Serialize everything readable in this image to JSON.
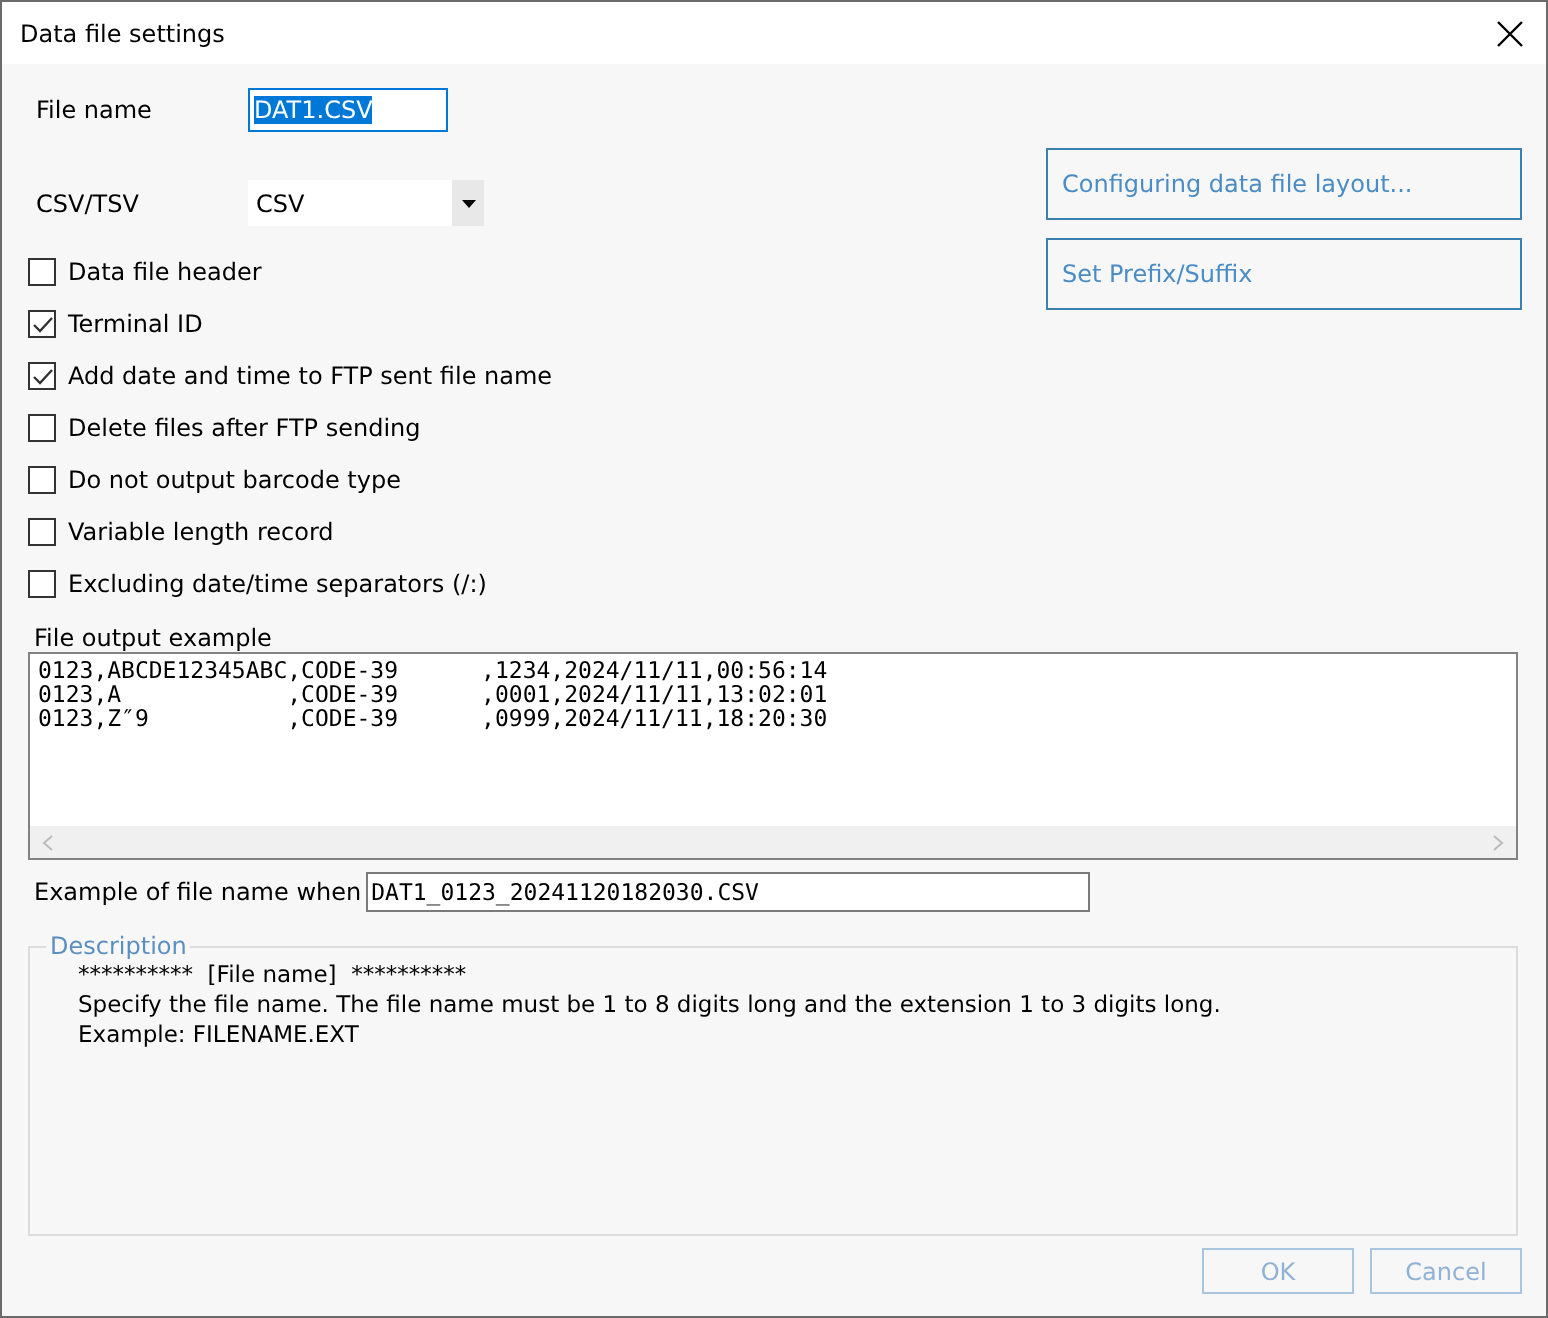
{
  "window": {
    "title": "Data file settings"
  },
  "file_name": {
    "label": "File name",
    "value": "DAT1.CSV"
  },
  "format": {
    "label": "CSV/TSV",
    "value": "CSV"
  },
  "options": [
    {
      "label": "Data file header",
      "checked": false
    },
    {
      "label": "Terminal ID",
      "checked": true
    },
    {
      "label": "Add date and time to FTP sent file name",
      "checked": true
    },
    {
      "label": "Delete files after FTP sending",
      "checked": false
    },
    {
      "label": "Do not output barcode type",
      "checked": false
    },
    {
      "label": "Variable length record",
      "checked": false
    },
    {
      "label": "Excluding date/time separators (/:)",
      "checked": false
    }
  ],
  "side_buttons": [
    "Configuring data file layout...",
    "Set Prefix/Suffix"
  ],
  "output_example": {
    "label": "File output example",
    "lines": [
      "0123,ABCDE12345ABC,CODE-39      ,1234,2024/11/11,00:56:14",
      "0123,A            ,CODE-39      ,0001,2024/11/11,13:02:01",
      "0123,Z″9          ,CODE-39      ,0999,2024/11/11,18:20:30"
    ]
  },
  "file_name_example": {
    "label": "Example of file name when",
    "value": "DAT1_0123_20241120182030.CSV"
  },
  "description": {
    "title": "Description",
    "lines": [
      "**********  [File name]  **********",
      "Specify the file name. The file name must be 1 to 8 digits long and the extension 1 to 3 digits long.",
      "Example: FILENAME.EXT"
    ]
  },
  "buttons": [
    {
      "label": "OK",
      "disabled": true
    },
    {
      "label": "Cancel",
      "disabled": true
    }
  ]
}
